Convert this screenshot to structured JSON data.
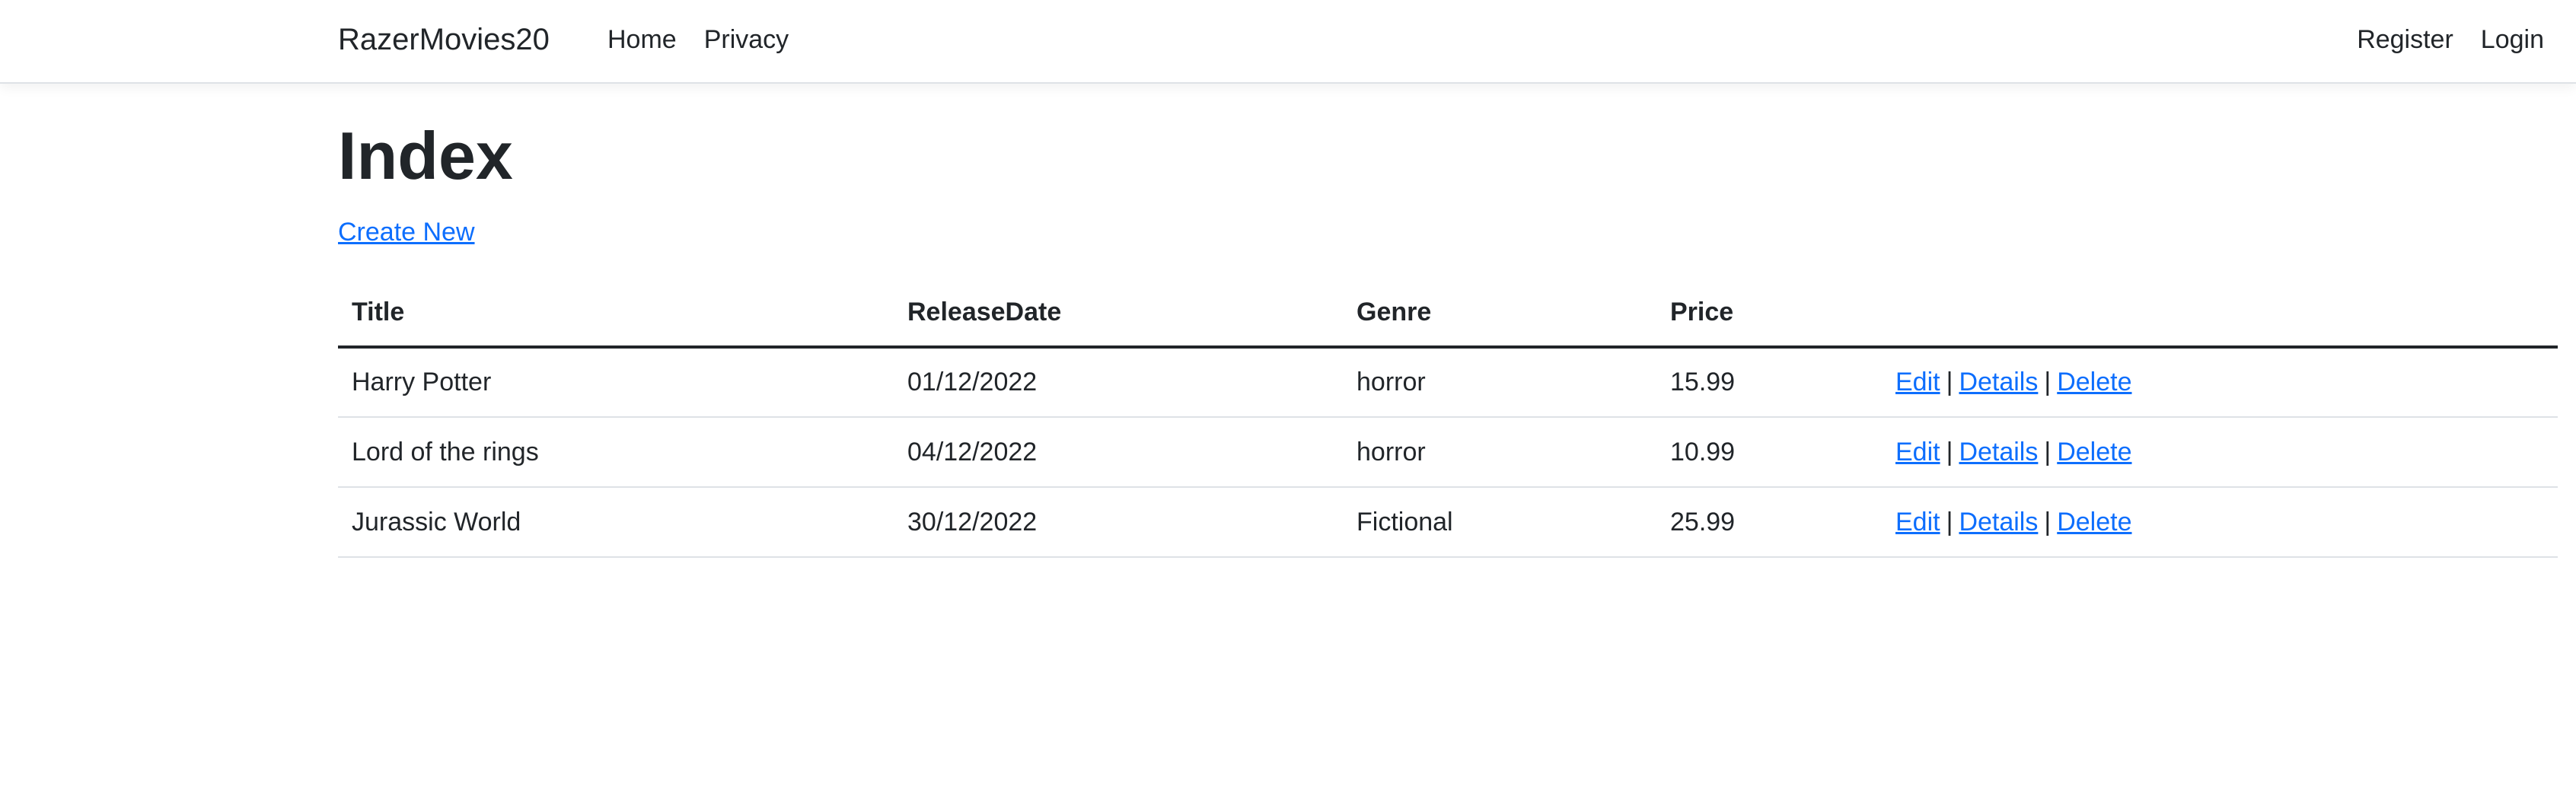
{
  "navbar": {
    "brand": "RazerMovies20",
    "left_links": [
      "Home",
      "Privacy"
    ],
    "right_links": [
      "Register",
      "Login"
    ]
  },
  "page": {
    "title": "Index",
    "create_new": "Create New"
  },
  "table": {
    "headers": [
      "Title",
      "ReleaseDate",
      "Genre",
      "Price",
      ""
    ],
    "rows": [
      {
        "title": "Harry Potter",
        "release_date": "01/12/2022",
        "genre": "horror",
        "price": "15.99"
      },
      {
        "title": "Lord of the rings",
        "release_date": "04/12/2022",
        "genre": "horror",
        "price": "10.99"
      },
      {
        "title": "Jurassic World",
        "release_date": "30/12/2022",
        "genre": "Fictional",
        "price": "25.99"
      }
    ],
    "actions": {
      "edit": "Edit",
      "details": "Details",
      "delete": "Delete",
      "separator": "|"
    }
  },
  "colors": {
    "link": "#0d6efd",
    "text": "#212529",
    "border": "#dee2e6"
  }
}
